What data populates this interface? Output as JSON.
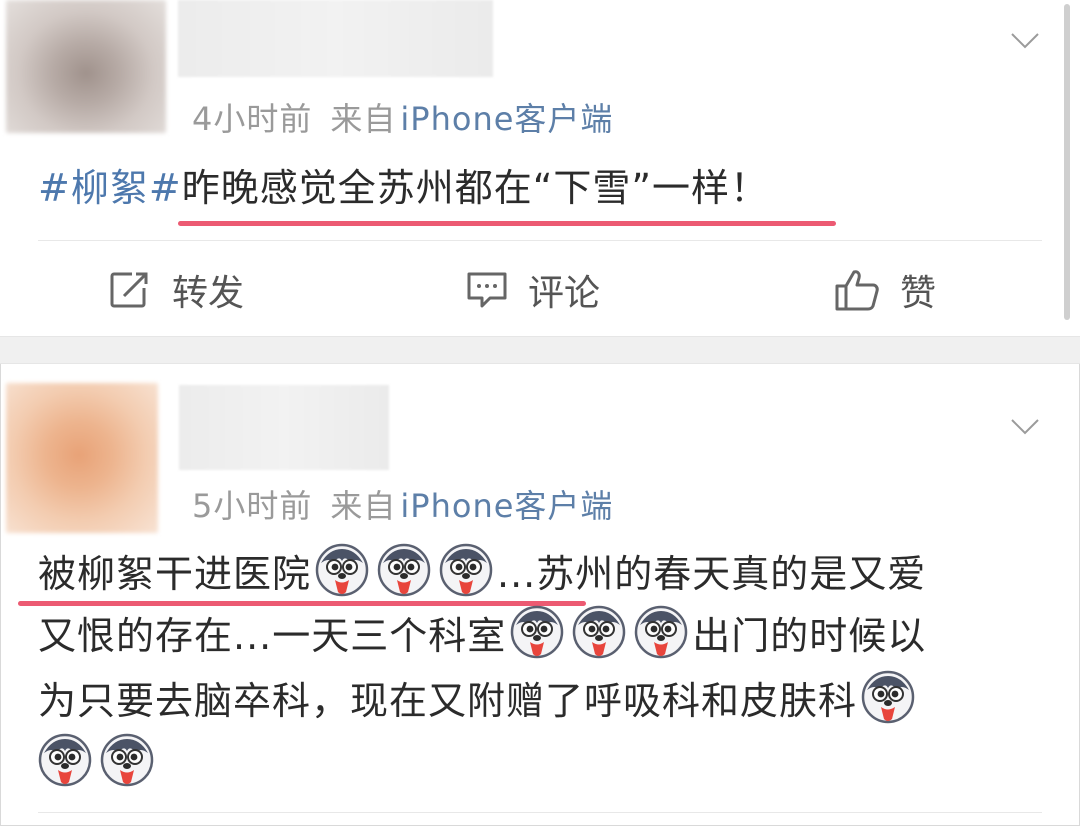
{
  "posts": [
    {
      "meta": {
        "time": "4小时前",
        "source_prefix": "来自",
        "client": "iPhone客户端"
      },
      "text": {
        "hashtag": "#柳絮#",
        "body": "昨晚感觉全苏州都在“下雪”一样！"
      },
      "actions": {
        "repost": "转发",
        "comment": "评论",
        "like": "赞"
      }
    },
    {
      "meta": {
        "time": "5小时前",
        "source_prefix": "来自",
        "client": "iPhone客户端"
      },
      "text": {
        "line1_a": "被柳絮干进医院",
        "line1_b": "...苏州的春天真的是又爱",
        "line2_a": "又恨的存在...一天三个科室",
        "line2_b": "出门的时候以",
        "line3": "为只要去脑卒科，现在又附赠了呼吸科和皮肤科"
      }
    }
  ],
  "icons": {
    "avatar_1": "blurred-avatar",
    "avatar_2": "blurred-avatar",
    "more": "chevron-down-icon",
    "repost": "repost-icon",
    "comment": "comment-icon",
    "like": "thumbs-up-icon",
    "emoji": "husky-emoji"
  },
  "colors": {
    "link": "#5d7fa8",
    "hashtag": "#4d78ad",
    "highlight_underline": "#ec5a72",
    "meta": "#9a9a9a"
  }
}
